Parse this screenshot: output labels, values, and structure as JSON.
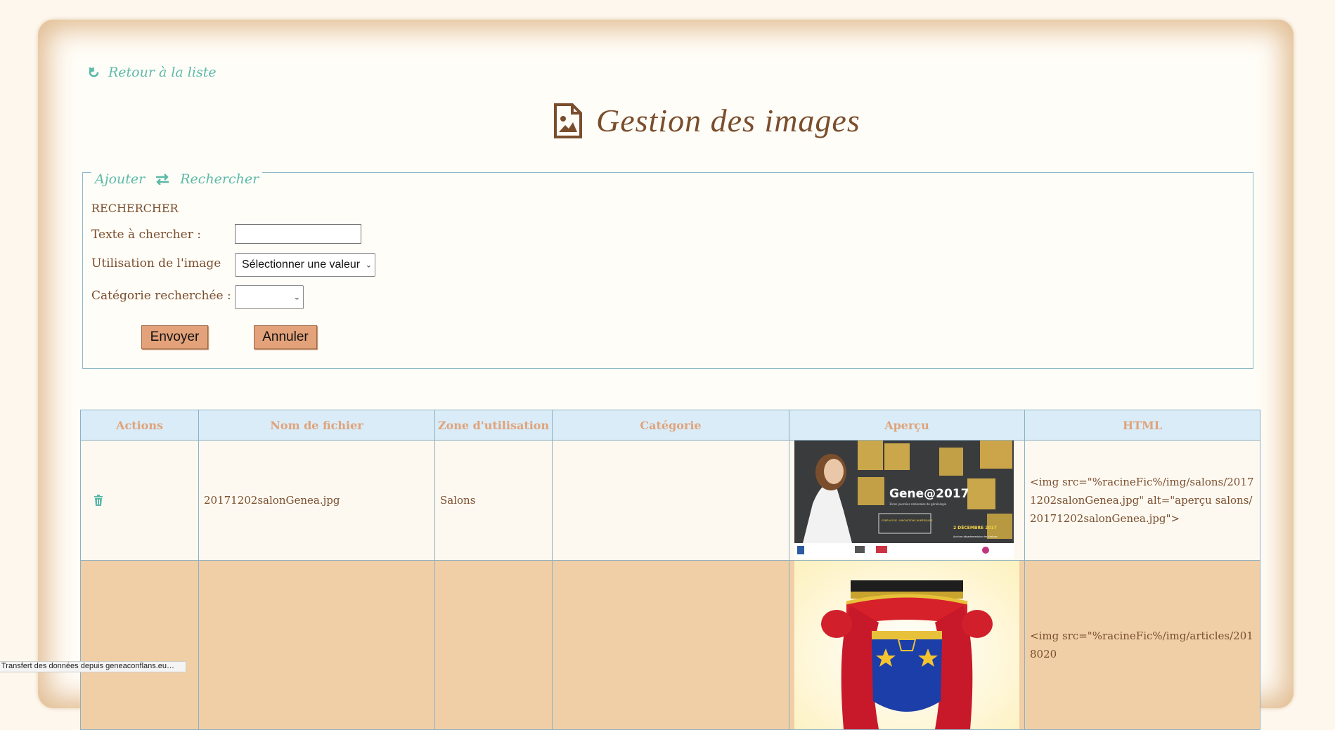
{
  "nav": {
    "back_label": "Retour à la liste"
  },
  "page": {
    "title": "Gestion des images"
  },
  "search": {
    "tab_add": "Ajouter",
    "tab_search": "Rechercher",
    "heading": "RECHERCHER",
    "text_label": "Texte à chercher :",
    "text_value": "",
    "usage_label": "Utilisation de l'image",
    "usage_selected": "Sélectionner une valeur",
    "category_label": "Catégorie recherchée :",
    "category_selected": "",
    "submit_label": "Envoyer",
    "cancel_label": "Annuler"
  },
  "table": {
    "headers": [
      "Actions",
      "Nom de fichier",
      "Zone d'utilisation",
      "Catégorie",
      "Aperçu",
      "HTML"
    ],
    "rows": [
      {
        "filename": "20171202salonGenea.jpg",
        "zone": "Salons",
        "category": "",
        "preview": {
          "title": "Gene@2017",
          "subtitle": "1ères journées nationales de généalogie",
          "box": "GÉNÉALOGIE : INNOVATIONS NUMÉRIQUES",
          "date": "2 DÉCEMBRE 2017",
          "place": "Archives départementales des Yvelines"
        },
        "html": "<img src=\"%racineFic%/img/salons/20171202salonGenea.jpg\" alt=\"aperçu salons/20171202salonGenea.jpg\">"
      },
      {
        "filename": "",
        "zone": "",
        "category": "",
        "html": "<img src=\"%racineFic%/img/articles/2018020"
      }
    ]
  },
  "status_bar": "Transfert des données depuis geneaconflans.eu…",
  "colors": {
    "accent": "#5cb9a8",
    "brown": "#7a4e2d",
    "button": "#e3a27a",
    "header_bg": "#d9ecf8",
    "row_alt": "#f0cfa7"
  }
}
